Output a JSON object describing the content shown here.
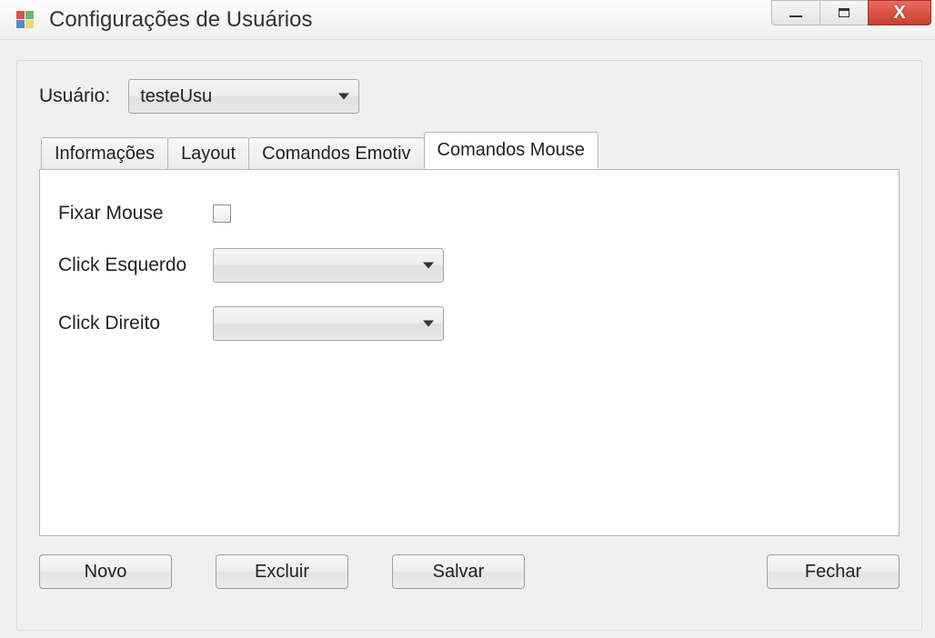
{
  "window": {
    "title": "Configurações de Usuários"
  },
  "user_row": {
    "label": "Usuário:",
    "selected": "testeUsu"
  },
  "tabs": [
    {
      "label": "Informações",
      "active": false
    },
    {
      "label": "Layout",
      "active": false
    },
    {
      "label": "Comandos Emotiv",
      "active": false
    },
    {
      "label": "Comandos Mouse",
      "active": true
    }
  ],
  "mouse_tab": {
    "fixar_label": "Fixar Mouse",
    "fixar_checked": false,
    "left_click_label": "Click Esquerdo",
    "left_click_value": "",
    "right_click_label": "Click Direito",
    "right_click_value": ""
  },
  "buttons": {
    "novo": "Novo",
    "excluir": "Excluir",
    "salvar": "Salvar",
    "fechar": "Fechar"
  }
}
